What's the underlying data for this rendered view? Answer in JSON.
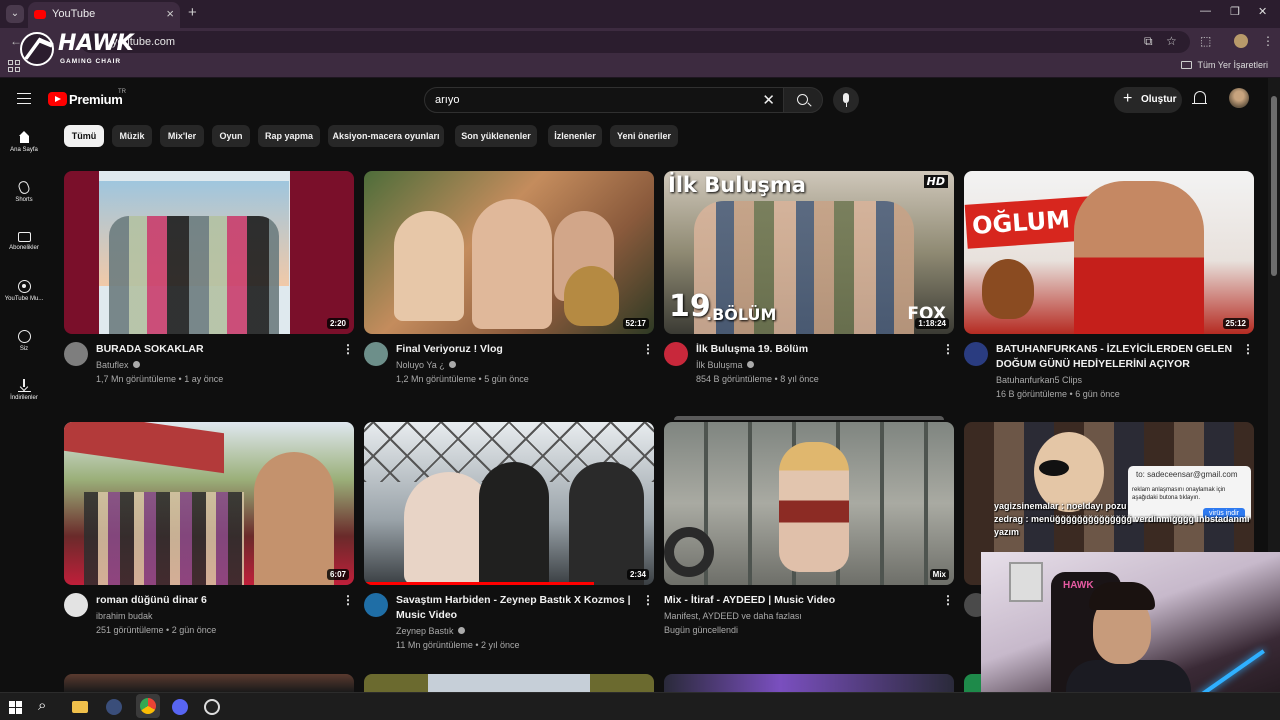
{
  "browser": {
    "tab_title": "YouTube",
    "url": "youtube.com",
    "bookmarks_folder": "Tüm Yer İşaretleri",
    "icons": [
      "tab-search-icon",
      "youtube-favicon",
      "close-icon",
      "plus-icon",
      "minimize-icon",
      "restore-icon",
      "close-window-icon",
      "back-icon",
      "cast-icon",
      "star-icon",
      "extensions-icon",
      "profile-icon",
      "kebab-menu-icon",
      "apps-icon",
      "folder-icon"
    ]
  },
  "overlay_logo": {
    "word": "HAWK",
    "sub": "GAMING CHAIR"
  },
  "masthead": {
    "logo_text": "Premium",
    "logo_region": "TR",
    "search_value": "arıyo",
    "create_label": "Oluştur"
  },
  "chips": [
    "Tümü",
    "Müzik",
    "Mix'ler",
    "Oyun",
    "Rap yapma",
    "Aksiyon-macera oyunları",
    "Son yüklenenler",
    "İzlenenler",
    "Yeni öneriler"
  ],
  "nav": [
    {
      "label": "Ana Sayfa",
      "icon": "home-icon"
    },
    {
      "label": "Shorts",
      "icon": "shorts-icon"
    },
    {
      "label": "Abonelikler",
      "icon": "subscriptions-icon"
    },
    {
      "label": "YouTube Mu...",
      "icon": "youtube-music-icon"
    },
    {
      "label": "Siz",
      "icon": "you-icon"
    },
    {
      "label": "İndirilenler",
      "icon": "downloads-icon"
    }
  ],
  "videos": [
    {
      "title": "BURADA SOKAKLAR",
      "channel": "Batuflex",
      "verified": true,
      "meta": "1,7 Mn görüntüleme • 1 ay önce",
      "duration": "2:20"
    },
    {
      "title": "Final Veriyoruz ! Vlog",
      "channel": "Noluyo Ya ¿",
      "verified": true,
      "meta": "1,2 Mn görüntüleme • 5 gün önce",
      "duration": "52:17"
    },
    {
      "title": "İlk Buluşma 19. Bölüm",
      "channel": "İlk Buluşma",
      "verified": true,
      "meta": "854 B görüntüleme • 8 yıl önce",
      "duration": "1:18:24",
      "thumb_text": [
        "İlk Buluşma",
        "19",
        ".BÖLÜM",
        "HD",
        "FOX"
      ]
    },
    {
      "title": "BATUHANFURKAN5 - İZLEYİCİLERDEN GELEN DOĞUM GÜNÜ HEDİYELERİNİ AÇIYOR",
      "channel": "Batuhanfurkan5 Clips",
      "verified": false,
      "meta": "16 B görüntüleme • 6 gün önce",
      "duration": "25:12",
      "thumb_text": [
        "OĞLUM BU NE?"
      ]
    },
    {
      "title": "roman düğünü dinar 6",
      "channel": "ibrahim budak",
      "verified": false,
      "meta": "251 görüntüleme • 2 gün önce",
      "duration": "6:07"
    },
    {
      "title": "Savaştım Harbiden - Zeynep Bastık X Kozmos | Music Video",
      "channel": "Zeynep Bastık",
      "verified": true,
      "meta": "11 Mn görüntüleme • 2 yıl önce",
      "duration": "2:34"
    },
    {
      "title": "Mix - İtiraf - AYDEED | Music Video",
      "channel": "Manifest, AYDEED ve daha fazlası",
      "verified": false,
      "meta": "Bugün güncellendi",
      "duration": "Mix"
    },
    {
      "title": "",
      "channel": "",
      "verified": false,
      "meta": "",
      "duration": ""
    }
  ],
  "stream_overlay": {
    "mail_to": "to: sadeceensar@gmail.com",
    "mail_msg": "reklam anlaşmasını onaylamak için aşağıdaki butona tıklayın.",
    "mail_button": "virüs indir",
    "chat_line1": "yagizsinemalar : noeldayı pozu",
    "chat_line2": "zedrag : menüğğğğğğğğğğğğğğ verdinmiğğğğ inbstadanmı yazım",
    "webcam_chair_logo": "HAWK"
  },
  "taskbar": {
    "icons": [
      "windows-start-icon",
      "search-icon",
      "file-explorer-icon",
      "app-icon",
      "chrome-icon",
      "discord-icon",
      "obs-icon"
    ]
  },
  "colors": {
    "background": "#0f0f0f",
    "browser_frame": "#2b1d2e",
    "youtube_red": "#ff0000",
    "chip_active": "#f1f1f1",
    "chip": "#272727",
    "meta_text": "#aaaaaa"
  }
}
